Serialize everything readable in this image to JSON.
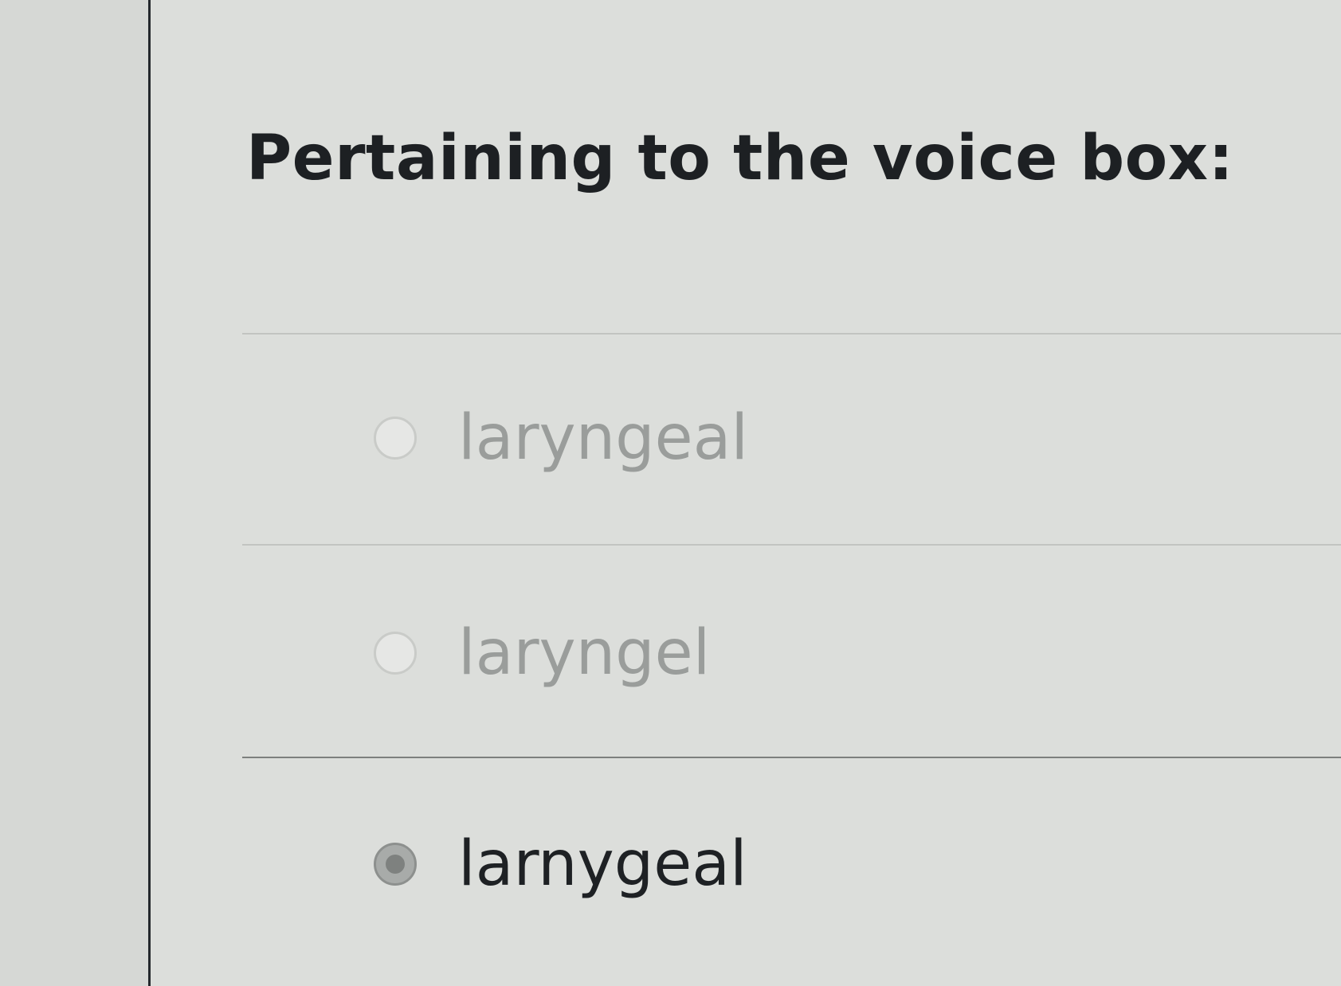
{
  "question": {
    "text": "Pertaining to the voice box:"
  },
  "options": [
    {
      "label": "laryngeal",
      "selected": false
    },
    {
      "label": "laryngel",
      "selected": false
    },
    {
      "label": "larnygeal",
      "selected": true
    }
  ]
}
